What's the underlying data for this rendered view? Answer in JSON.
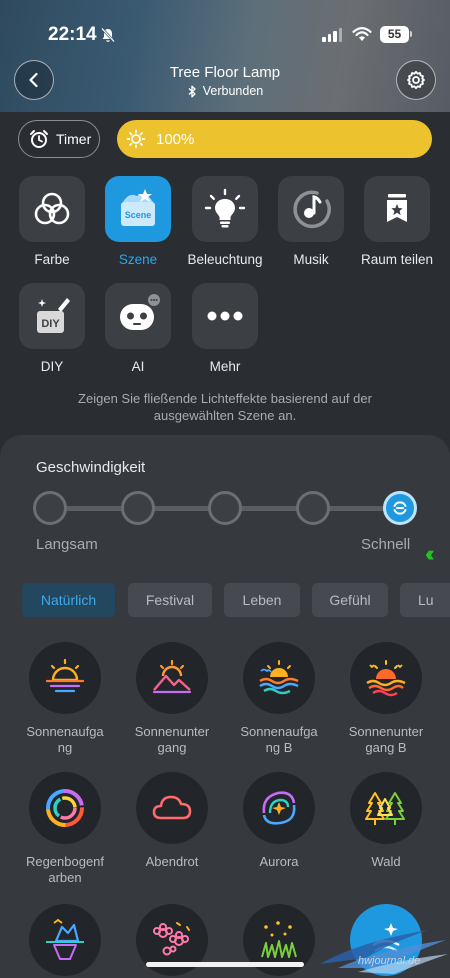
{
  "status_bar": {
    "time": "22:14",
    "battery": "55"
  },
  "header": {
    "title": "Tree Floor Lamp",
    "status": "Verbunden"
  },
  "controls": {
    "timer_label": "Timer",
    "brightness": "100%"
  },
  "modes": [
    {
      "label": "Farbe",
      "icon": "color-circles-icon"
    },
    {
      "label": "Szene",
      "icon": "scene-icon",
      "badge": "Scene"
    },
    {
      "label": "Beleuchtung",
      "icon": "bulb-icon"
    },
    {
      "label": "Musik",
      "icon": "music-icon"
    },
    {
      "label": "Raum teilen",
      "icon": "share-room-icon"
    },
    {
      "label": "DIY",
      "icon": "diy-icon",
      "badge": "DIY"
    },
    {
      "label": "AI",
      "icon": "ai-robot-icon"
    },
    {
      "label": "Mehr",
      "icon": "more-icon"
    }
  ],
  "description": "Zeigen Sie fließende Lichteffekte basierend auf der ausgewählten Szene an.",
  "speed": {
    "label": "Geschwindigkeit",
    "slow": "Langsam",
    "fast": "Schnell",
    "level": 5,
    "levels": 5
  },
  "categories": [
    {
      "label": "Natürlich",
      "active": true
    },
    {
      "label": "Festival"
    },
    {
      "label": "Leben"
    },
    {
      "label": "Gefühl"
    },
    {
      "label": "Lu"
    }
  ],
  "scenes": [
    {
      "line1": "Sonnenaufga",
      "line2": "ng",
      "icon": "sunrise-icon"
    },
    {
      "line1": "Sonnenunter",
      "line2": "gang",
      "icon": "sunset-icon"
    },
    {
      "line1": "Sonnenaufga",
      "line2": "ng B",
      "icon": "sunrise-b-icon"
    },
    {
      "line1": "Sonnenunter",
      "line2": "gang B",
      "icon": "sunset-b-icon"
    },
    {
      "line1": "Regenbogenf",
      "line2": "arben",
      "icon": "rainbow-icon"
    },
    {
      "line1": "Abendrot",
      "line2": "",
      "icon": "evening-cloud-icon"
    },
    {
      "line1": "Aurora",
      "line2": "",
      "icon": "aurora-icon"
    },
    {
      "line1": "Wald",
      "line2": "",
      "icon": "forest-icon"
    }
  ],
  "watermark": "hwjournal.de",
  "colors": {
    "accent": "#1e98de",
    "brightness": "#edc22f",
    "background": "#2a2d32",
    "panel": "#36393e",
    "annotation_arrow": "#1ec224"
  }
}
